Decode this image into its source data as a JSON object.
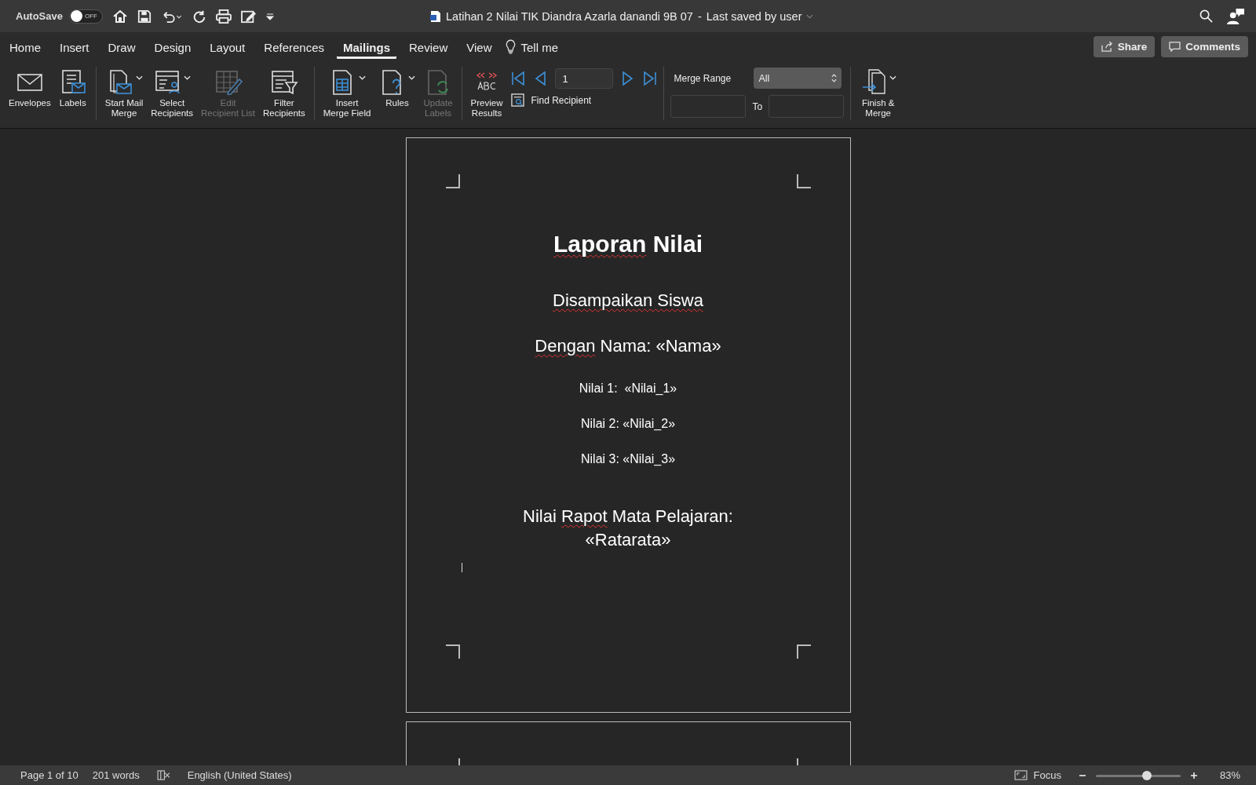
{
  "title_bar": {
    "autosave": {
      "label": "AutoSave",
      "on": false,
      "state_text": "OFF"
    },
    "document_title": "Latihan 2 Nilai TIK Diandra Azarla danandi 9B 07",
    "separator": "-",
    "saved_status": "Last saved by user"
  },
  "tabs": [
    {
      "label": "Home",
      "selected": false
    },
    {
      "label": "Insert",
      "selected": false
    },
    {
      "label": "Draw",
      "selected": false
    },
    {
      "label": "Design",
      "selected": false
    },
    {
      "label": "Layout",
      "selected": false
    },
    {
      "label": "References",
      "selected": false
    },
    {
      "label": "Mailings",
      "selected": true
    },
    {
      "label": "Review",
      "selected": false
    },
    {
      "label": "View",
      "selected": false
    }
  ],
  "tell_me": "Tell me",
  "share": "Share",
  "comments": "Comments",
  "ribbon": {
    "groups": [
      {
        "items": [
          {
            "label": "Envelopes",
            "disabled": false,
            "dropdown": false
          },
          {
            "label": "Labels",
            "disabled": false,
            "dropdown": false
          }
        ]
      },
      {
        "items": [
          {
            "label": "Start Mail\nMerge",
            "disabled": false,
            "dropdown": true
          },
          {
            "label": "Select\nRecipients",
            "disabled": false,
            "dropdown": true
          },
          {
            "label": "Edit\nRecipient List",
            "disabled": true,
            "dropdown": false
          },
          {
            "label": "Filter\nRecipients",
            "disabled": false,
            "dropdown": false
          }
        ]
      },
      {
        "items": [
          {
            "label": "Insert\nMerge Field",
            "disabled": false,
            "dropdown": true
          },
          {
            "label": "Rules",
            "disabled": false,
            "dropdown": true
          },
          {
            "label": "Update\nLabels",
            "disabled": true,
            "dropdown": false
          }
        ]
      }
    ],
    "preview": {
      "label": "Preview\nResults",
      "record": "1",
      "find_recipient": "Find Recipient"
    },
    "merge_range": {
      "label": "Merge Range",
      "value": "All",
      "to": "To"
    },
    "finish": {
      "label": "Finish &\nMerge",
      "dropdown": true
    }
  },
  "document": {
    "lines": [
      {
        "kind": "title",
        "segments": [
          {
            "text": "Laporan",
            "misspelled": true
          },
          {
            "text": " Nilai",
            "misspelled": false
          }
        ]
      },
      {
        "kind": "heading",
        "segments": [
          {
            "text": "Disampaikan Siswa",
            "misspelled": true
          }
        ]
      },
      {
        "kind": "heading",
        "segments": [
          {
            "text": "Dengan",
            "misspelled": true
          },
          {
            "text": " Nama: «Nama»",
            "misspelled": false
          }
        ]
      },
      {
        "kind": "body",
        "segments": [
          {
            "text": "Nilai 1:  «Nilai_1»",
            "misspelled": false
          }
        ]
      },
      {
        "kind": "body",
        "segments": [
          {
            "text": "Nilai 2: «Nilai_2»",
            "misspelled": false
          }
        ]
      },
      {
        "kind": "body",
        "segments": [
          {
            "text": "Nilai 3: «Nilai_3»",
            "misspelled": false
          }
        ]
      },
      {
        "kind": "heading",
        "segments": [
          {
            "text": "Nilai ",
            "misspelled": false
          },
          {
            "text": "Rapot",
            "misspelled": true
          },
          {
            "text": " Mata Pelajaran:",
            "misspelled": false
          }
        ]
      },
      {
        "kind": "heading_cont",
        "segments": [
          {
            "text": "«Ratarata»",
            "misspelled": false
          }
        ]
      }
    ]
  },
  "status_bar": {
    "page": "Page 1 of 10",
    "words": "201 words",
    "language": "English (United States)",
    "focus": "Focus",
    "zoom": {
      "level": 0.6,
      "text": "83%"
    }
  }
}
